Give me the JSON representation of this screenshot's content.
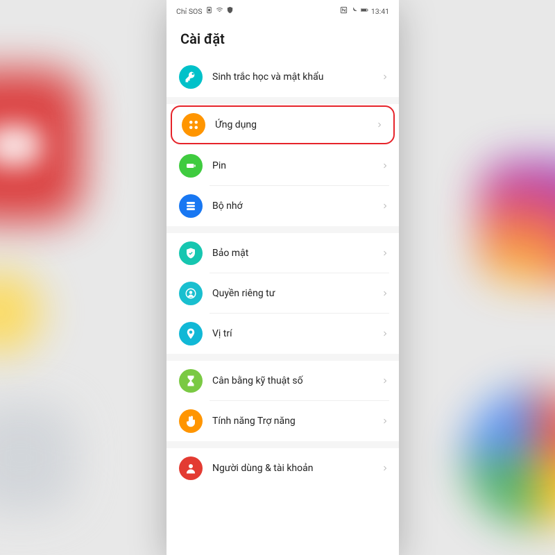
{
  "statusbar": {
    "carrier": "Chỉ SOS",
    "time": "13:41"
  },
  "title": "Cài đặt",
  "items": [
    {
      "label": "Sinh trắc học và mật khẩu",
      "icon": "key-icon",
      "color": "c-cyan",
      "highlight": false,
      "group_start": true
    },
    {
      "label": "Ứng dụng",
      "icon": "apps-icon",
      "color": "c-orange",
      "highlight": true,
      "group_start": true
    },
    {
      "label": "Pin",
      "icon": "battery-icon",
      "color": "c-green",
      "highlight": false,
      "group_start": false
    },
    {
      "label": "Bộ nhớ",
      "icon": "storage-icon",
      "color": "c-blue",
      "highlight": false,
      "group_start": false
    },
    {
      "label": "Bảo mật",
      "icon": "shield-check-icon",
      "color": "c-teal",
      "highlight": false,
      "group_start": true
    },
    {
      "label": "Quyền riêng tư",
      "icon": "privacy-icon",
      "color": "c-cyan2",
      "highlight": false,
      "group_start": false
    },
    {
      "label": "Vị trí",
      "icon": "location-icon",
      "color": "c-cyan3",
      "highlight": false,
      "group_start": false
    },
    {
      "label": "Cân bằng kỹ thuật số",
      "icon": "hourglass-icon",
      "color": "c-lime",
      "highlight": false,
      "group_start": true
    },
    {
      "label": "Tính năng Trợ năng",
      "icon": "hand-icon",
      "color": "c-orange2",
      "highlight": false,
      "group_start": false
    },
    {
      "label": "Người dùng & tài khoản",
      "icon": "user-icon",
      "color": "c-red",
      "highlight": false,
      "group_start": true
    }
  ]
}
